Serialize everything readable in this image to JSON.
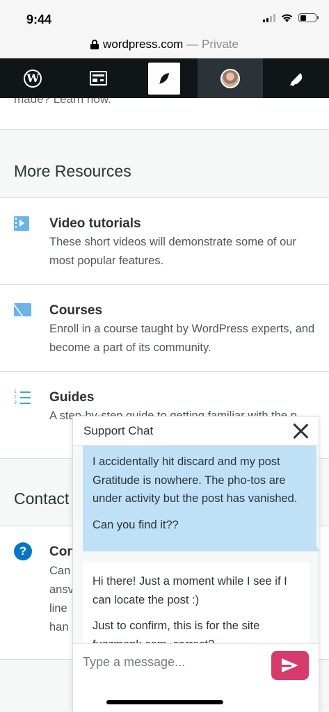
{
  "status_bar": {
    "time": "9:44"
  },
  "browser": {
    "domain": "wordpress.com",
    "mode": "— Private"
  },
  "masterbar": {
    "items": [
      {
        "name": "wordpress-logo-icon",
        "label": "W"
      },
      {
        "name": "reader-icon"
      },
      {
        "name": "write-icon"
      },
      {
        "name": "avatar"
      },
      {
        "name": "notifications-icon"
      }
    ]
  },
  "content": {
    "cut_off_text": "made? Learn now.",
    "more_resources": {
      "heading": "More Resources",
      "items": [
        {
          "title": "Video tutorials",
          "description": "These short videos will demonstrate some of our most popular features.",
          "icon": "video-icon"
        },
        {
          "title": "Courses",
          "description": "Enroll in a course taught by WordPress experts, and become a part of its community.",
          "icon": "mail-icon"
        },
        {
          "title": "Guides",
          "description": "A step-by-step guide to getting familiar with the p",
          "icon": "list-icon"
        }
      ]
    },
    "contact": {
      "heading": "Contact",
      "item_title": "Con",
      "item_desc_lines": [
        "Can",
        "ansv",
        "line",
        "han"
      ]
    }
  },
  "chat": {
    "title": "Support Chat",
    "messages": {
      "user": [
        "I accidentally hit discard and my post Gratitude is nowhere. The pho-tos are under activity but the post has vanished.",
        "Can you find it??"
      ],
      "support": [
        "Hi there! Just a moment while I see if I can locate the post :)",
        "Just to confirm, this is for the site fuzzmonk.com, correct?"
      ]
    },
    "input_placeholder": "Type a message...",
    "accent_color": "#d63c6b"
  }
}
